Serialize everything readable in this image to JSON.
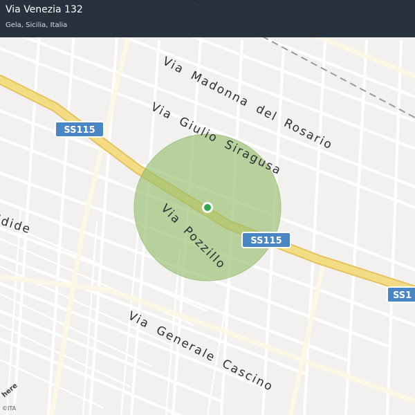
{
  "header": {
    "title": "Via Venezia 132",
    "subtitle": "Gela, Sicilia, Italia"
  },
  "map": {
    "streets": [
      "Via Madonna del Rosario",
      "Via Giulio Siragusa",
      "Via Pozzillo",
      "Via Generale Cascino",
      "idide"
    ],
    "road_shields": [
      "SS115",
      "SS115",
      "SS1"
    ],
    "colors": {
      "background": "#f2f1ef",
      "road": "#ffffff",
      "highway": "#f0d77a",
      "radius_fill": "#a8cc86",
      "marker": "#2ea84a",
      "shield": "#4a86c4",
      "header": "#1e2a36"
    }
  },
  "attribution": {
    "logo": "here",
    "copyright": "©ITA"
  }
}
